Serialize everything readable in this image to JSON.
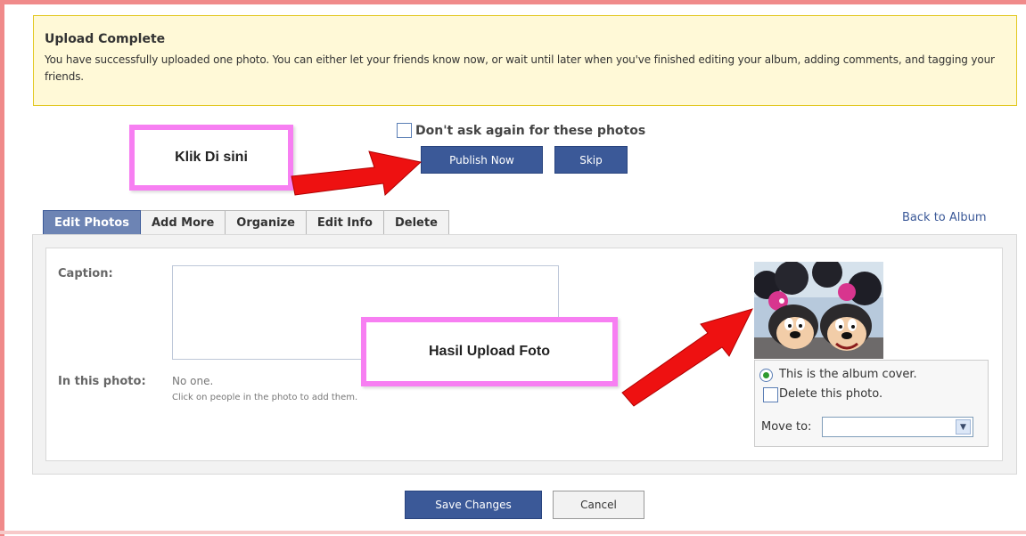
{
  "notice": {
    "title": "Upload Complete",
    "body": "You have successfully uploaded one photo. You can either let your friends know now, or wait until later when you've finished editing your album, adding comments, and tagging your friends."
  },
  "dont_ask": {
    "label": "Don't ask again for these photos",
    "checked": false
  },
  "actions": {
    "publish_label": "Publish Now",
    "skip_label": "Skip"
  },
  "callouts": {
    "click_here": "Klik Di sini",
    "upload_result": "Hasil Upload Foto"
  },
  "tabs": [
    {
      "label": "Edit Photos",
      "active": true
    },
    {
      "label": "Add More",
      "active": false
    },
    {
      "label": "Organize",
      "active": false
    },
    {
      "label": "Edit Info",
      "active": false
    },
    {
      "label": "Delete",
      "active": false
    }
  ],
  "back_link": "Back to Album",
  "form": {
    "caption_label": "Caption:",
    "caption_value": "",
    "in_photo_label": "In this photo:",
    "in_photo_value": "No one.",
    "in_photo_hint": "Click on people in the photo to add them."
  },
  "photo_options": {
    "cover_label": "This is the album cover.",
    "cover_selected": true,
    "delete_label": "Delete this photo.",
    "delete_checked": false,
    "move_label": "Move to:",
    "move_value": ""
  },
  "footer": {
    "save_label": "Save Changes",
    "cancel_label": "Cancel"
  },
  "colors": {
    "brand_blue": "#3b5998",
    "tab_active": "#6d84b4",
    "notice_bg": "#fff9d7",
    "notice_border": "#e2c822",
    "callout_border": "#f77ff2",
    "arrow_red": "#ee1111"
  }
}
